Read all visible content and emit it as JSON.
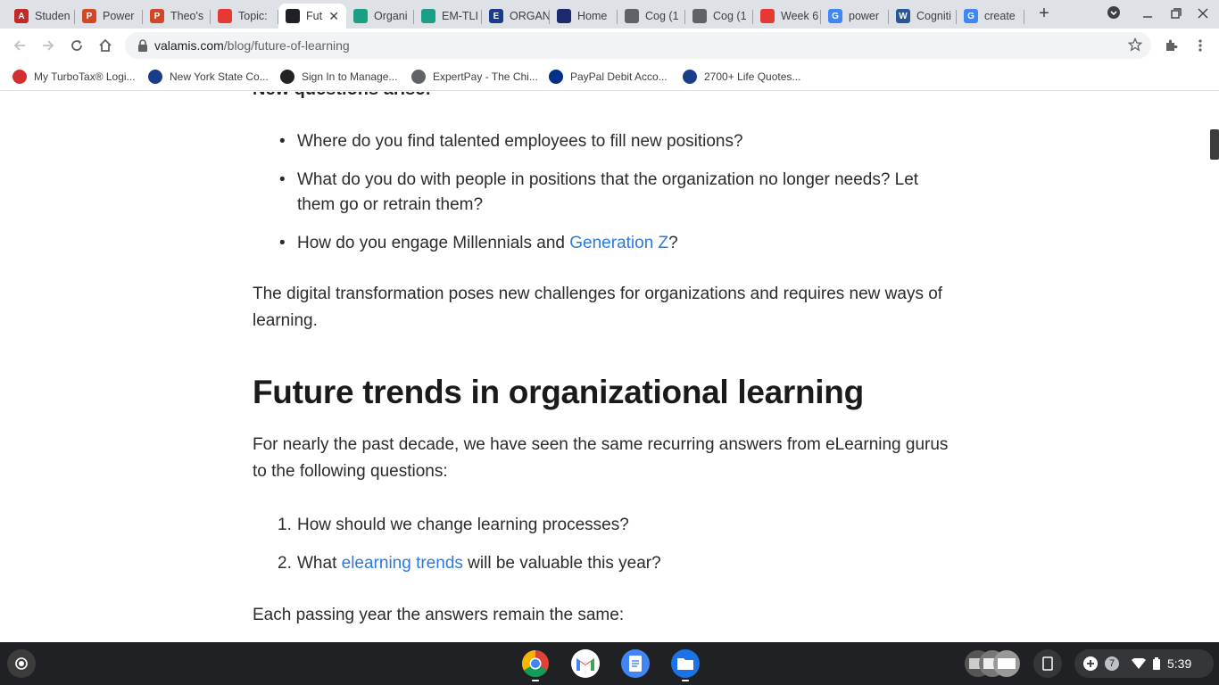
{
  "tabs": [
    {
      "title": "Studen",
      "favicon": "A",
      "fav_color": "#c62828",
      "left": 0
    },
    {
      "title": "Power",
      "favicon": "P",
      "fav_color": "#d24726"
    },
    {
      "title": "Theo's",
      "favicon": "P",
      "fav_color": "#d24726"
    },
    {
      "title": "Topic:",
      "favicon": "",
      "fav_color": "#e53935"
    },
    {
      "title": "Fut",
      "favicon": "",
      "fav_color": "#202124",
      "active": true
    },
    {
      "title": "Organi",
      "favicon": "",
      "fav_color": "#1a9e84"
    },
    {
      "title": "EM-TLI",
      "favicon": "",
      "fav_color": "#1a9e84"
    },
    {
      "title": "ORGAN",
      "favicon": "E",
      "fav_color": "#1a3c8c"
    },
    {
      "title": "Home",
      "favicon": "",
      "fav_color": "#1a2a6c"
    },
    {
      "title": "Cog (1",
      "favicon": "",
      "fav_color": "#5f6368"
    },
    {
      "title": "Cog (1",
      "favicon": "",
      "fav_color": "#5f6368"
    },
    {
      "title": "Week 6",
      "favicon": "",
      "fav_color": "#e53935"
    },
    {
      "title": "power",
      "favicon": "G",
      "fav_color": "#4285f4"
    },
    {
      "title": "Cogniti",
      "favicon": "W",
      "fav_color": "#2b5797"
    },
    {
      "title": "create",
      "favicon": "G",
      "fav_color": "#4285f4"
    }
  ],
  "address": {
    "domain": "valamis.com",
    "path": "/blog/future-of-learning"
  },
  "bookmarks": [
    {
      "label": "My TurboTax® Logi...",
      "color": "#d32f2f"
    },
    {
      "label": "New York State Co...",
      "color": "#1a3c8c"
    },
    {
      "label": "Sign In to Manage...",
      "color": "#222"
    },
    {
      "label": "ExpertPay - The Chi...",
      "color": "#5f6368"
    },
    {
      "label": "PayPal Debit Acco...",
      "color": "#003087"
    },
    {
      "label": "2700+ Life Quotes...",
      "color": "#1a3c8c"
    }
  ],
  "article": {
    "cut_heading": "New questions arise:",
    "bullets": [
      {
        "text": "Where do you find talented employees to fill new positions?"
      },
      {
        "text": "What do you do with people in positions that the organization no longer needs? Let them go or retrain them?"
      },
      {
        "pre": "How do you engage Millennials and ",
        "link": "Generation Z",
        "post": "?"
      }
    ],
    "para1": "The digital transformation poses new challenges for organizations and requires new ways of learning.",
    "heading": "Future trends in organizational learning",
    "para2": "For nearly the past decade, we have seen the same recurring answers from eLearning gurus to the following questions:",
    "numbered": [
      {
        "num": "1.",
        "text": "How should we change learning processes?"
      },
      {
        "num": "2.",
        "pre": "What ",
        "link": "elearning trends",
        "post": " will be valuable this year?"
      }
    ],
    "para3": "Each passing year the answers remain the same:"
  },
  "shelf": {
    "notification_count": "7",
    "time": "5:39"
  }
}
